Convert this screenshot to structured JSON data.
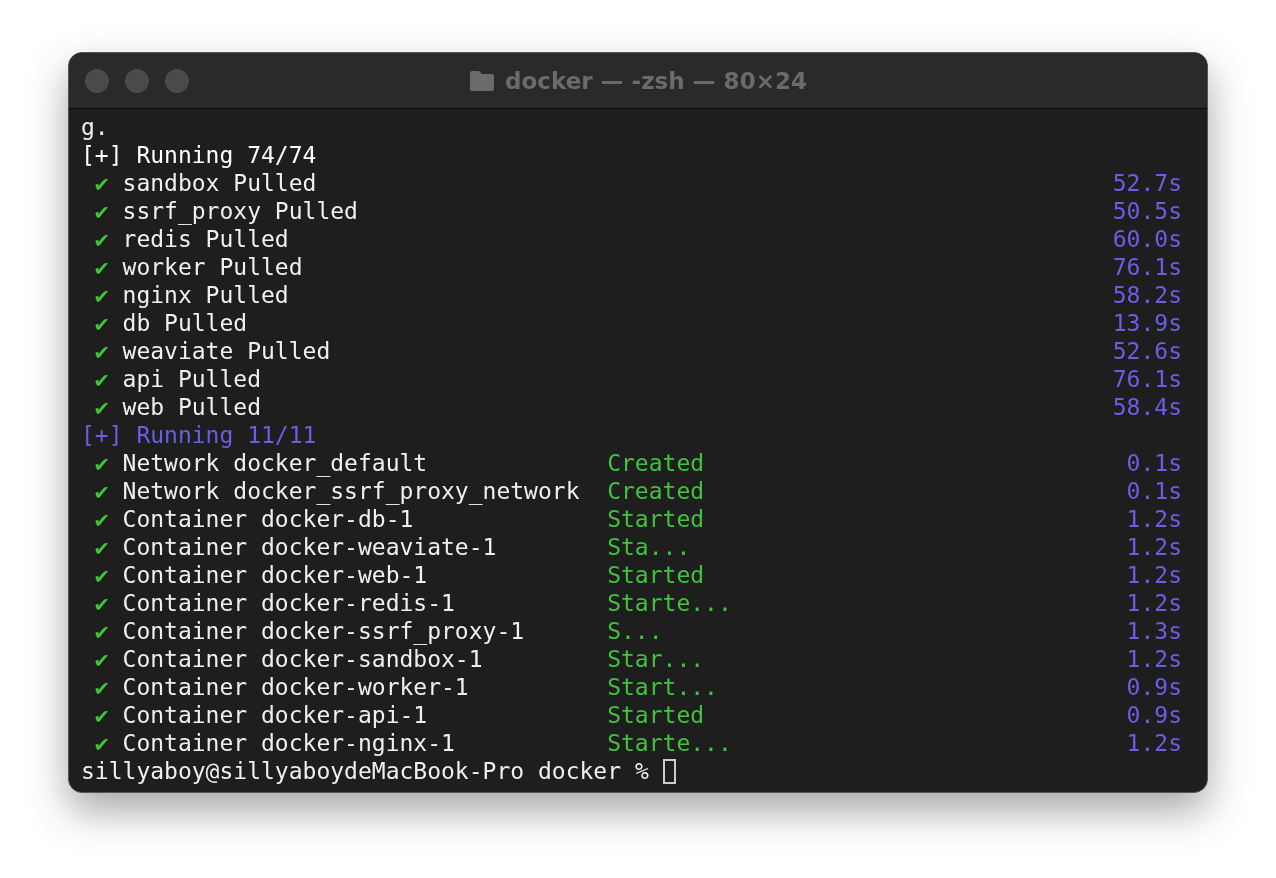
{
  "window": {
    "title": "docker — -zsh — 80×24"
  },
  "terminal": {
    "first_line": "g.",
    "sections": [
      {
        "header": "[+] Running 74/74",
        "color": "#ffffff",
        "items": [
          {
            "mark": "✔",
            "name": "sandbox Pulled",
            "time": "52.7s"
          },
          {
            "mark": "✔",
            "name": "ssrf_proxy Pulled",
            "time": "50.5s"
          },
          {
            "mark": "✔",
            "name": "redis Pulled",
            "time": "60.0s"
          },
          {
            "mark": "✔",
            "name": "worker Pulled",
            "time": "76.1s"
          },
          {
            "mark": "✔",
            "name": "nginx Pulled",
            "time": "58.2s"
          },
          {
            "mark": "✔",
            "name": "db Pulled",
            "time": "13.9s"
          },
          {
            "mark": "✔",
            "name": "weaviate Pulled",
            "time": "52.6s"
          },
          {
            "mark": "✔",
            "name": "api Pulled",
            "time": "76.1s"
          },
          {
            "mark": "✔",
            "name": "web Pulled",
            "time": "58.4s"
          }
        ]
      },
      {
        "header": "[+] Running 11/11",
        "color": "#6a5ee6",
        "items": [
          {
            "mark": "✔",
            "name": "Network docker_default",
            "status": "Created",
            "time": "0.1s"
          },
          {
            "mark": "✔",
            "name": "Network docker_ssrf_proxy_network",
            "status": "Created",
            "time": "0.1s"
          },
          {
            "mark": "✔",
            "name": "Container docker-db-1",
            "status": "Started",
            "time": "1.2s"
          },
          {
            "mark": "✔",
            "name": "Container docker-weaviate-1",
            "status": "Sta...",
            "time": "1.2s"
          },
          {
            "mark": "✔",
            "name": "Container docker-web-1",
            "status": "Started",
            "time": "1.2s"
          },
          {
            "mark": "✔",
            "name": "Container docker-redis-1",
            "status": "Starte...",
            "time": "1.2s"
          },
          {
            "mark": "✔",
            "name": "Container docker-ssrf_proxy-1",
            "status": "S...",
            "time": "1.3s"
          },
          {
            "mark": "✔",
            "name": "Container docker-sandbox-1",
            "status": "Star...",
            "time": "1.2s"
          },
          {
            "mark": "✔",
            "name": "Container docker-worker-1",
            "status": "Start...",
            "time": "0.9s"
          },
          {
            "mark": "✔",
            "name": "Container docker-api-1",
            "status": "Started",
            "time": "0.9s"
          },
          {
            "mark": "✔",
            "name": "Container docker-nginx-1",
            "status": "Starte...",
            "time": "1.2s"
          }
        ]
      }
    ],
    "prompt": "sillyaboy@sillyaboydeMacBook-Pro docker %"
  }
}
